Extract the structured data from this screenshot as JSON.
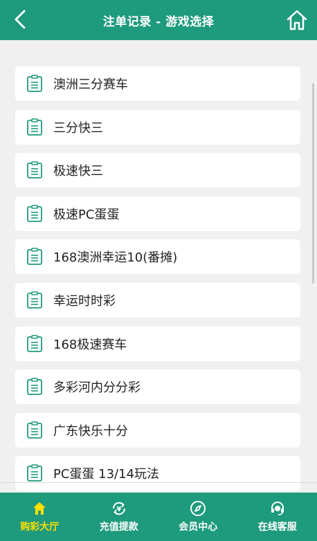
{
  "header": {
    "title": "注单记录 - 游戏选择"
  },
  "games": [
    {
      "label": "澳洲三分赛车"
    },
    {
      "label": "三分快三"
    },
    {
      "label": "极速快三"
    },
    {
      "label": "极速PC蛋蛋"
    },
    {
      "label": "168澳洲幸运10(番摊)"
    },
    {
      "label": "幸运时时彩"
    },
    {
      "label": "168极速赛车"
    },
    {
      "label": "多彩河内分分彩"
    },
    {
      "label": "广东快乐十分"
    },
    {
      "label": "PC蛋蛋 13/14玩法"
    }
  ],
  "tabbar": {
    "items": [
      {
        "label": "购彩大厅",
        "icon": "home-icon",
        "active": true
      },
      {
        "label": "充值提款",
        "icon": "yen-cycle-icon",
        "active": false
      },
      {
        "label": "会员中心",
        "icon": "compass-icon",
        "active": false
      },
      {
        "label": "在线客服",
        "icon": "headset-icon",
        "active": false
      }
    ]
  },
  "colors": {
    "brand": "#1e9a7c",
    "active_tab": "#ffe000",
    "background": "#f0f0f0"
  }
}
